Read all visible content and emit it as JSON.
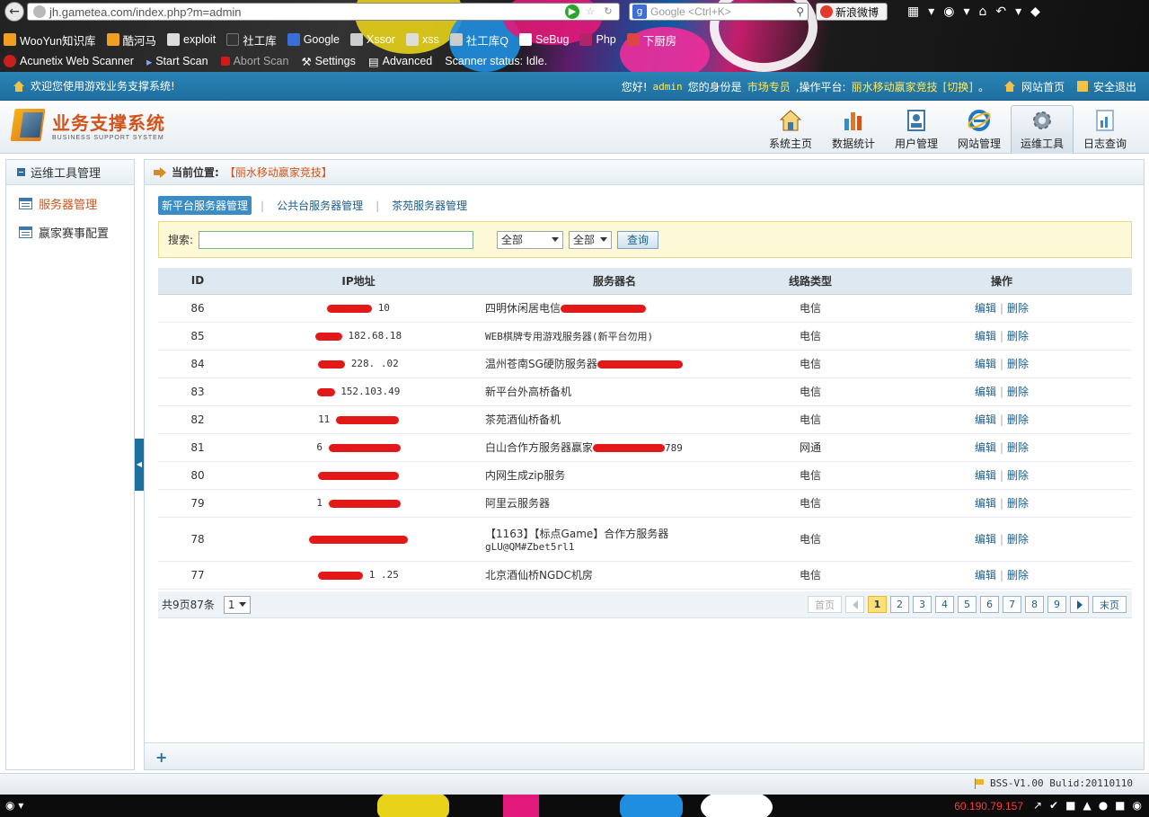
{
  "browser": {
    "url": "jh.gametea.com/index.php?m=admin",
    "search_placeholder": "Google <Ctrl+K>",
    "weibo_label": "新浪微博",
    "bookmarks": [
      "WooYun知识库",
      "酷河马",
      "exploit",
      "社工库",
      "Google",
      "Xssor",
      "xss",
      "社工库Q",
      "SeBug",
      "Php",
      "下厨房"
    ],
    "acunetix": {
      "title": "Acunetix Web Scanner",
      "start": "Start Scan",
      "abort": "Abort Scan",
      "settings": "Settings",
      "advanced": "Advanced",
      "status": "Scanner status: Idle."
    }
  },
  "topbar": {
    "welcome": "欢迎您使用游戏业务支撑系统!",
    "hello": "您好!",
    "username": "admin",
    "role_label": "您的身份是",
    "role": "市场专员",
    "platform_label": ",操作平台:",
    "platform": "丽水移动嬴家竞技",
    "switch": "[切换]",
    "dot": "。",
    "home_link": "网站首页",
    "logout_link": "安全退出"
  },
  "header": {
    "title": "业务支撑系统",
    "subtitle": "BUSINESS SUPPORT SYSTEM",
    "nav": [
      {
        "label": "系统主页",
        "icon": "house-icon"
      },
      {
        "label": "数据统计",
        "icon": "bar-chart-icon"
      },
      {
        "label": "用户管理",
        "icon": "user-book-icon"
      },
      {
        "label": "网站管理",
        "icon": "ie-icon"
      },
      {
        "label": "运维工具",
        "icon": "gear-icon"
      },
      {
        "label": "日志查询",
        "icon": "log-icon"
      }
    ]
  },
  "sidebar": {
    "header": "运维工具管理",
    "items": [
      {
        "label": "服务器管理"
      },
      {
        "label": "嬴家赛事配置"
      }
    ]
  },
  "breadcrumb": {
    "label": "当前位置:",
    "value": "【丽水移动嬴家竞技】"
  },
  "subtabs": [
    {
      "label": "新平台服务器管理"
    },
    {
      "label": "公共台服务器管理"
    },
    {
      "label": "茶苑服务器管理"
    }
  ],
  "search": {
    "label": "搜索:",
    "value": "",
    "select1": "全部",
    "select2": "全部",
    "button": "查询"
  },
  "table": {
    "headers": [
      "ID",
      "IP地址",
      "服务器名",
      "线路类型",
      "操作"
    ],
    "edit": "编辑",
    "delete": "删除",
    "rows": [
      {
        "id": "86",
        "ip": "10",
        "name": "四明休闲居电信",
        "line": "电信"
      },
      {
        "id": "85",
        "ip": "182.68.18",
        "name": "WEB棋牌专用游戏服务器(新平台勿用)",
        "line": "电信"
      },
      {
        "id": "84",
        "ip": "228.  .02",
        "name": "温州苍南SG硬防服务器",
        "line": "电信"
      },
      {
        "id": "83",
        "ip": "152.103.49",
        "name": "新平台外高桥备机",
        "line": "电信"
      },
      {
        "id": "82",
        "ip": "11",
        "name": "茶苑酒仙桥备机",
        "line": "电信"
      },
      {
        "id": "81",
        "ip": "6",
        "name": "白山合作方服务器嬴家",
        "name_tail": "789",
        "line": "网通"
      },
      {
        "id": "80",
        "ip": "",
        "name": "内网生成zip服务",
        "line": "电信"
      },
      {
        "id": "79",
        "ip": "1",
        "name": "阿里云服务器",
        "line": "电信"
      },
      {
        "id": "78",
        "ip": "",
        "name": "【1163】【标点Game】合作方服务器",
        "name2": "gLU@QM#Zbet5rl1",
        "line": "电信"
      },
      {
        "id": "77",
        "ip": "1  .25",
        "name": "北京酒仙桥NGDC机房",
        "line": "电信"
      }
    ]
  },
  "pager": {
    "total": "共9页87条",
    "page_select": "1",
    "first": "首页",
    "last": "末页",
    "pages": [
      "1",
      "2",
      "3",
      "4",
      "5",
      "6",
      "7",
      "8",
      "9"
    ],
    "current": "1"
  },
  "status": {
    "version": "BSS-V1.00 Bulid:20110110"
  },
  "taskbar": {
    "ip": "60.190.79.157"
  }
}
